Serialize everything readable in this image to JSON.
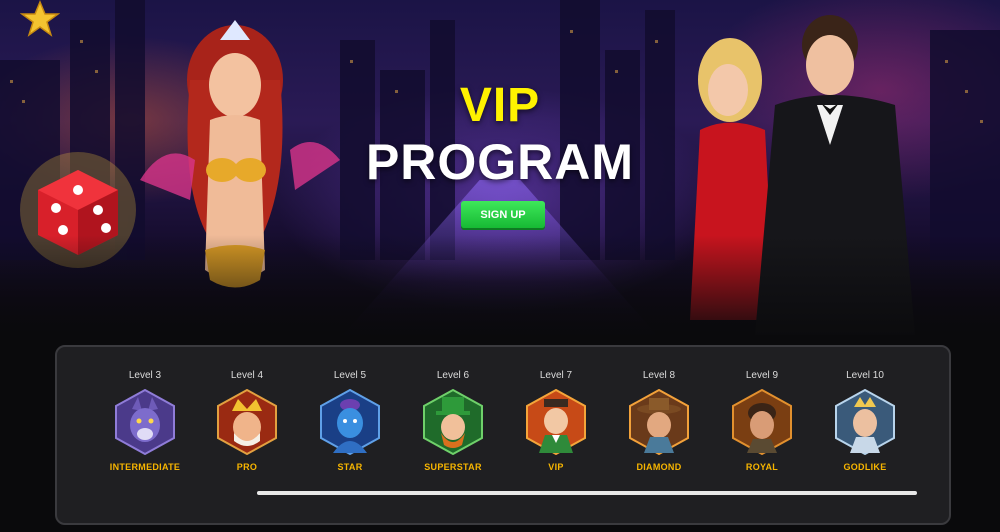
{
  "hero": {
    "title_line1": "VIP",
    "title_line2": "PROGRAM",
    "signup_label": "SIGN UP"
  },
  "colors": {
    "vip_yellow": "#fff200",
    "signup_green": "#22c03c",
    "level_name": "#f7b500",
    "panel_bg": "#1f1f22"
  },
  "levels": [
    {
      "label": "Level 3",
      "name": "INTERMEDIATE",
      "icon": "wolf-icon"
    },
    {
      "label": "Level 4",
      "name": "PRO",
      "icon": "king-icon"
    },
    {
      "label": "Level 5",
      "name": "STAR",
      "icon": "genie-icon"
    },
    {
      "label": "Level 6",
      "name": "SUPERSTAR",
      "icon": "leprechaun-icon"
    },
    {
      "label": "Level 7",
      "name": "VIP",
      "icon": "gentleman-icon"
    },
    {
      "label": "Level 8",
      "name": "DIAMOND",
      "icon": "cowboy-icon"
    },
    {
      "label": "Level 9",
      "name": "ROYAL",
      "icon": "adventurer-icon"
    },
    {
      "label": "Level 10",
      "name": "GODLIKE",
      "icon": "warrior-icon"
    }
  ]
}
